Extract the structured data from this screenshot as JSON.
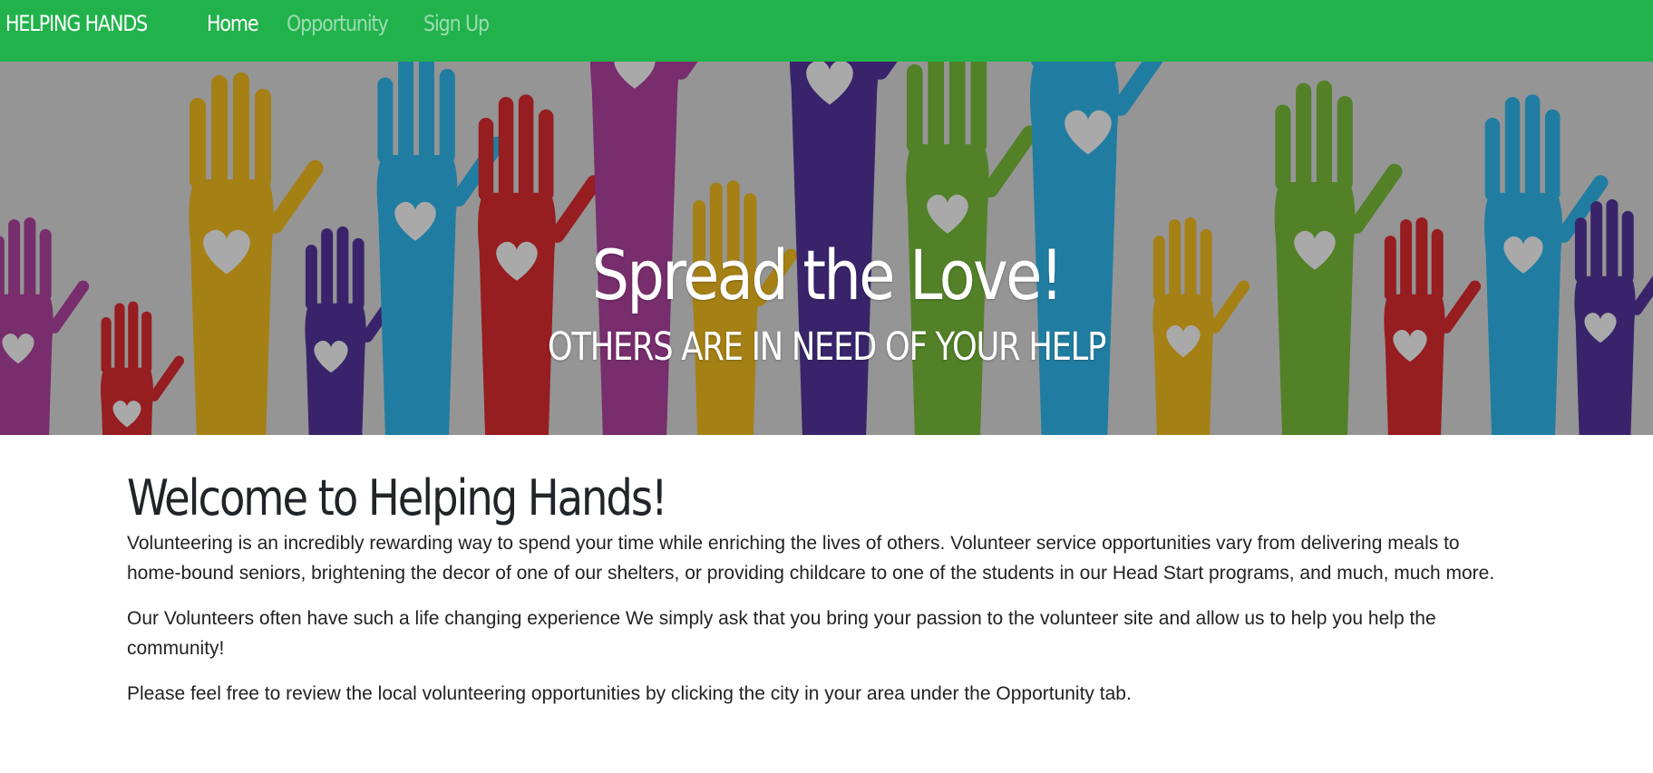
{
  "nav": {
    "brand": "HELPING HANDS",
    "links": [
      {
        "label": "Home",
        "active": true
      },
      {
        "label": "Opportunity",
        "active": false
      },
      {
        "label": "Sign Up",
        "active": false
      }
    ]
  },
  "hero": {
    "title": "Spread the Love!",
    "subtitle": "OTHERS ARE IN NEED OF YOUR HELP",
    "image": "raised-hands-with-hearts"
  },
  "main": {
    "heading": "Welcome to Helping Hands!",
    "paragraphs": [
      "Volunteering is an incredibly rewarding way to spend your time while enriching the lives of others. Volunteer service opportunities vary from delivering meals to home-bound seniors, brightening the decor of one of our shelters, or providing childcare to one of the students in our Head Start programs, and much, much more.",
      "Our Volunteers often have such a life changing experience We simply ask that you bring your passion to the volunteer site and allow us to help you help the community!",
      "Please feel free to review the local volunteering opportunities by clicking the city in your area under the Opportunity tab."
    ]
  },
  "colors": {
    "navbar": "#22b24c",
    "hand_yellow": "#d4a41c",
    "hand_blue": "#2aa0cf",
    "hand_red": "#c0262a",
    "hand_purple": "#4a2f8a",
    "hand_magenta": "#9a3a8c",
    "hand_green": "#6aa632"
  }
}
